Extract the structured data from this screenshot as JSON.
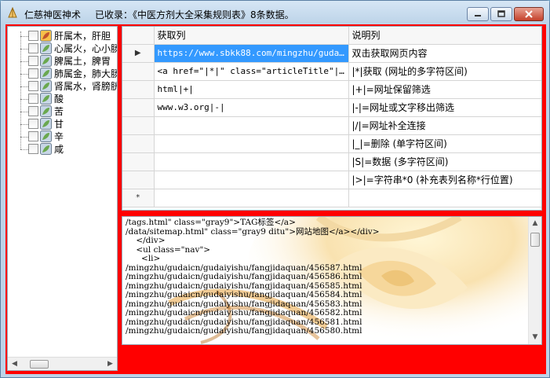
{
  "window": {
    "app_name": "仁慈神医神术",
    "record_info": "已收录：《中医方剂大全采集规则表》8条数据。"
  },
  "tree": {
    "items": [
      {
        "label": "肝属木，肝胆"
      },
      {
        "label": "心属火，心小肠"
      },
      {
        "label": "脾属土，脾胃"
      },
      {
        "label": "肺属金，肺大肠"
      },
      {
        "label": "肾属水，肾膀胱"
      },
      {
        "label": "酸"
      },
      {
        "label": "苦"
      },
      {
        "label": "甘"
      },
      {
        "label": "辛"
      },
      {
        "label": "咸"
      }
    ]
  },
  "grid": {
    "columns": [
      "获取列",
      "说明列"
    ],
    "current_marker": "▶",
    "new_row_marker": "*",
    "rows": [
      {
        "fetch": "https://www.sbkk88.com/mingzhu/gudaic...",
        "desc": "双击获取网页内容"
      },
      {
        "fetch": "<a href=\"|*|\" class=\"articleTitle\"|*|",
        "desc": "|*|获取 (网址的多字符区间)"
      },
      {
        "fetch": "html|+|",
        "desc": "|+|=网址保留筛选"
      },
      {
        "fetch": "www.w3.org|-|",
        "desc": "|-|=网址或文字移出筛选"
      },
      {
        "fetch": "",
        "desc": "|/|=网址补全连接"
      },
      {
        "fetch": "",
        "desc": "|_|=删除 (单字符区间)"
      },
      {
        "fetch": "",
        "desc": "|S|=数据 (多字符区间)"
      },
      {
        "fetch": "",
        "desc": "|>|=字符串*0 (补充表列名称*行位置)"
      }
    ]
  },
  "output": {
    "lines": [
      "/tags.html\" class=\"gray9\">TAG标签</a>",
      "/data/sitemap.html\" class=\"gray9 ditu\">网站地图</a></div>",
      "    </div>",
      "    <ul class=\"nav\">",
      "      <li>",
      "/mingzhu/gudaicn/gudaiyishu/fangjidaquan/456587.html",
      "/mingzhu/gudaicn/gudaiyishu/fangjidaquan/456586.html",
      "/mingzhu/gudaicn/gudaiyishu/fangjidaquan/456585.html",
      "/mingzhu/gudaicn/gudaiyishu/fangjidaquan/456584.html",
      "/mingzhu/gudaicn/gudaiyishu/fangjidaquan/456583.html",
      "/mingzhu/gudaicn/gudaiyishu/fangjidaquan/456582.html",
      "/mingzhu/gudaicn/gudaiyishu/fangjidaquan/456581.html",
      "/mingzhu/gudaicn/gudaiyishu/fangjidaquan/456580.html"
    ]
  },
  "colors": {
    "frame": "#ff0000",
    "selection": "#3399ff",
    "close_button": "#c4412a"
  },
  "icons": {
    "app": "app-logo-icon",
    "tree_leaf": "herb-leaf-icon",
    "minimize": "minimize-icon",
    "maximize": "maximize-icon",
    "close": "close-icon"
  }
}
